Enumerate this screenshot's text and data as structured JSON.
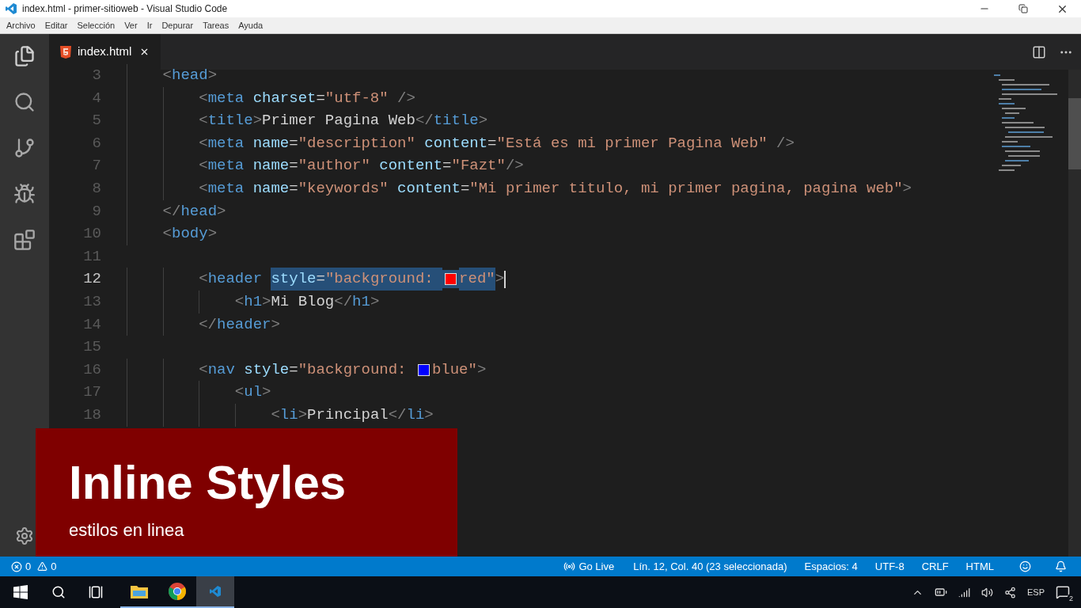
{
  "window": {
    "title": "index.html - primer-sitioweb - Visual Studio Code"
  },
  "menu": [
    "Archivo",
    "Editar",
    "Selección",
    "Ver",
    "Ir",
    "Depurar",
    "Tareas",
    "Ayuda"
  ],
  "tabs": [
    {
      "label": "index.html",
      "selected": true
    }
  ],
  "editor": {
    "lines": [
      {
        "number": "3",
        "current": false,
        "parts": [
          {
            "kind": "code",
            "selected": false,
            "tokens": [
              {
                "kind": "punct",
                "text": "    <"
              },
              {
                "kind": "tag",
                "text": "head"
              },
              {
                "kind": "punct",
                "text": ">"
              }
            ]
          }
        ]
      },
      {
        "number": "4",
        "current": false,
        "parts": [
          {
            "kind": "code",
            "selected": false,
            "tokens": [
              {
                "kind": "punct",
                "text": "        <"
              },
              {
                "kind": "tag",
                "text": "meta"
              },
              {
                "kind": "attr",
                "text": " charset"
              },
              {
                "kind": "text",
                "text": "="
              },
              {
                "kind": "string",
                "text": "\"utf-8\""
              },
              {
                "kind": "punct",
                "text": " />"
              }
            ]
          }
        ]
      },
      {
        "number": "5",
        "current": false,
        "parts": [
          {
            "kind": "code",
            "selected": false,
            "tokens": [
              {
                "kind": "punct",
                "text": "        <"
              },
              {
                "kind": "tag",
                "text": "title"
              },
              {
                "kind": "punct",
                "text": ">"
              },
              {
                "kind": "text",
                "text": "Primer Pagina Web"
              },
              {
                "kind": "punct",
                "text": "</"
              },
              {
                "kind": "tag",
                "text": "title"
              },
              {
                "kind": "punct",
                "text": ">"
              }
            ]
          }
        ]
      },
      {
        "number": "6",
        "current": false,
        "parts": [
          {
            "kind": "code",
            "selected": false,
            "tokens": [
              {
                "kind": "punct",
                "text": "        <"
              },
              {
                "kind": "tag",
                "text": "meta"
              },
              {
                "kind": "attr",
                "text": " name"
              },
              {
                "kind": "text",
                "text": "="
              },
              {
                "kind": "string",
                "text": "\"description\""
              },
              {
                "kind": "attr",
                "text": " content"
              },
              {
                "kind": "text",
                "text": "="
              },
              {
                "kind": "string",
                "text": "\"Está es mi primer Pagina Web\""
              },
              {
                "kind": "punct",
                "text": " />"
              }
            ]
          }
        ]
      },
      {
        "number": "7",
        "current": false,
        "parts": [
          {
            "kind": "code",
            "selected": false,
            "tokens": [
              {
                "kind": "punct",
                "text": "        <"
              },
              {
                "kind": "tag",
                "text": "meta"
              },
              {
                "kind": "attr",
                "text": " name"
              },
              {
                "kind": "text",
                "text": "="
              },
              {
                "kind": "string",
                "text": "\"author\""
              },
              {
                "kind": "attr",
                "text": " content"
              },
              {
                "kind": "text",
                "text": "="
              },
              {
                "kind": "string",
                "text": "\"Fazt\""
              },
              {
                "kind": "punct",
                "text": "/>"
              }
            ]
          }
        ]
      },
      {
        "number": "8",
        "current": false,
        "parts": [
          {
            "kind": "code",
            "selected": false,
            "tokens": [
              {
                "kind": "punct",
                "text": "        <"
              },
              {
                "kind": "tag",
                "text": "meta"
              },
              {
                "kind": "attr",
                "text": " name"
              },
              {
                "kind": "text",
                "text": "="
              },
              {
                "kind": "string",
                "text": "\"keywords\""
              },
              {
                "kind": "attr",
                "text": " content"
              },
              {
                "kind": "text",
                "text": "="
              },
              {
                "kind": "string",
                "text": "\"Mi primer titulo, mi primer pagina, pagina web\""
              },
              {
                "kind": "punct",
                "text": ">"
              }
            ]
          }
        ]
      },
      {
        "number": "9",
        "current": false,
        "parts": [
          {
            "kind": "code",
            "selected": false,
            "tokens": [
              {
                "kind": "punct",
                "text": "    </"
              },
              {
                "kind": "tag",
                "text": "head"
              },
              {
                "kind": "punct",
                "text": ">"
              }
            ]
          }
        ]
      },
      {
        "number": "10",
        "current": false,
        "parts": [
          {
            "kind": "code",
            "selected": false,
            "tokens": [
              {
                "kind": "punct",
                "text": "    <"
              },
              {
                "kind": "tag",
                "text": "body"
              },
              {
                "kind": "punct",
                "text": ">"
              }
            ]
          }
        ]
      },
      {
        "number": "11",
        "current": false
      },
      {
        "number": "12",
        "current": true,
        "parts": [
          {
            "kind": "code",
            "selected": false,
            "tokens": [
              {
                "kind": "punct",
                "text": "        <"
              },
              {
                "kind": "tag",
                "text": "header "
              }
            ]
          },
          {
            "kind": "code",
            "selected": true,
            "tokens": [
              {
                "kind": "attr",
                "text": "style"
              },
              {
                "kind": "text",
                "text": "="
              },
              {
                "kind": "string",
                "text": "\"background: "
              }
            ]
          },
          {
            "kind": "swatch",
            "selected": true,
            "color": "#ff0000"
          },
          {
            "kind": "code",
            "selected": true,
            "tokens": [
              {
                "kind": "string",
                "text": "red\""
              }
            ]
          },
          {
            "kind": "code",
            "selected": false,
            "tokens": [
              {
                "kind": "punct",
                "text": ">"
              }
            ]
          }
        ]
      },
      {
        "number": "13",
        "current": false,
        "parts": [
          {
            "kind": "code",
            "selected": false,
            "tokens": [
              {
                "kind": "punct",
                "text": "            <"
              },
              {
                "kind": "tag",
                "text": "h1"
              },
              {
                "kind": "punct",
                "text": ">"
              },
              {
                "kind": "text",
                "text": "Mi Blog"
              },
              {
                "kind": "punct",
                "text": "</"
              },
              {
                "kind": "tag",
                "text": "h1"
              },
              {
                "kind": "punct",
                "text": ">"
              }
            ]
          }
        ]
      },
      {
        "number": "14",
        "current": false,
        "parts": [
          {
            "kind": "code",
            "selected": false,
            "tokens": [
              {
                "kind": "punct",
                "text": "        </"
              },
              {
                "kind": "tag",
                "text": "header"
              },
              {
                "kind": "punct",
                "text": ">"
              }
            ]
          }
        ]
      },
      {
        "number": "15",
        "current": false
      },
      {
        "number": "16",
        "current": false,
        "parts": [
          {
            "kind": "code",
            "selected": false,
            "tokens": [
              {
                "kind": "punct",
                "text": "        <"
              },
              {
                "kind": "tag",
                "text": "nav"
              },
              {
                "kind": "attr",
                "text": " style"
              },
              {
                "kind": "text",
                "text": "="
              },
              {
                "kind": "string",
                "text": "\"background: "
              }
            ]
          },
          {
            "kind": "swatch",
            "selected": false,
            "color": "#0000ff"
          },
          {
            "kind": "code",
            "selected": false,
            "tokens": [
              {
                "kind": "string",
                "text": "blue\""
              },
              {
                "kind": "punct",
                "text": ">"
              }
            ]
          }
        ]
      },
      {
        "number": "17",
        "current": false,
        "parts": [
          {
            "kind": "code",
            "selected": false,
            "tokens": [
              {
                "kind": "punct",
                "text": "            <"
              },
              {
                "kind": "tag",
                "text": "ul"
              },
              {
                "kind": "punct",
                "text": ">"
              }
            ]
          }
        ]
      },
      {
        "number": "18",
        "current": false,
        "parts": [
          {
            "kind": "code",
            "selected": false,
            "tokens": [
              {
                "kind": "punct",
                "text": "                <"
              },
              {
                "kind": "tag",
                "text": "li"
              },
              {
                "kind": "punct",
                "text": ">"
              },
              {
                "kind": "text",
                "text": "Principal"
              },
              {
                "kind": "punct",
                "text": "</"
              },
              {
                "kind": "tag",
                "text": "li"
              },
              {
                "kind": "punct",
                "text": ">"
              }
            ]
          }
        ]
      }
    ]
  },
  "caption": {
    "title": "Inline Styles",
    "subtitle": "estilos en linea"
  },
  "status_bar": {
    "errors": "0",
    "warnings": "0",
    "items": [
      "Go Live",
      "Lín. 12, Col. 40 (23 seleccionada)",
      "Espacios: 4",
      "UTF-8",
      "CRLF",
      "HTML"
    ]
  },
  "taskbar": {
    "apps": [
      {
        "kind": "folder",
        "selected": false
      },
      {
        "kind": "chrome",
        "selected": false
      },
      {
        "kind": "vscode",
        "selected": true
      }
    ],
    "language": "ESP",
    "notifications": "2"
  }
}
